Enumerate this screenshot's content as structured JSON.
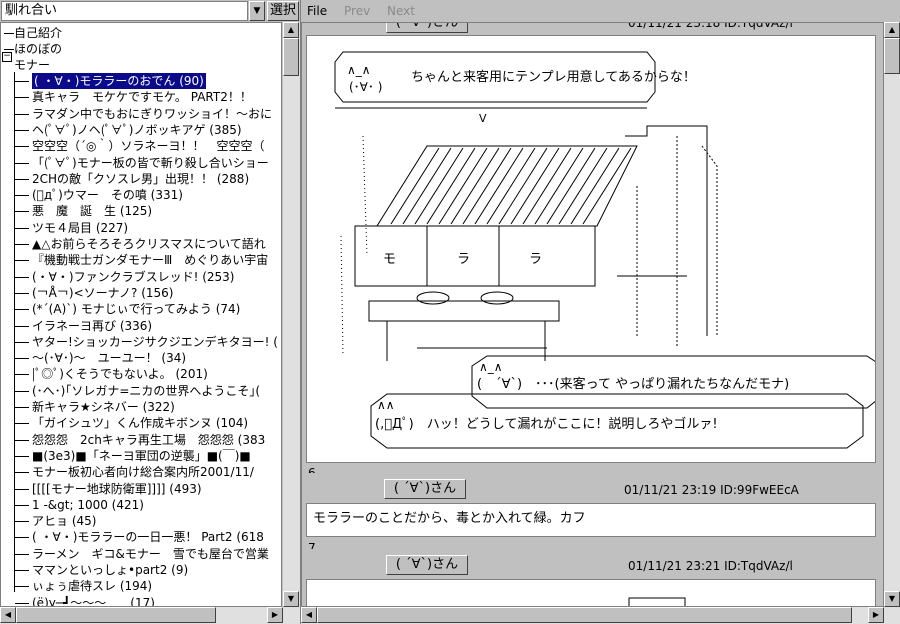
{
  "board": {
    "selected": "馴れ合い",
    "select_label": "選択"
  },
  "menu": {
    "file": "File",
    "prev": "Prev",
    "next": "Next"
  },
  "tree": {
    "top_items": [
      "自己紹介",
      "ほのぼの"
    ],
    "category": "モナー",
    "items": [
      "( ・∀・)モララーのおでん (90)",
      "真キャラ　モケケですモケ。 PART2！！",
      "ラマダン中でもおにぎりワッショイ！～おに",
      "ヘ(ﾟ∀ﾟ)ノヘ(ﾟ∀ﾟ)ノボッキアゲ (385)",
      "空空空（´◎｀）ソラネーヨ！！　空空空（",
      "「(ﾟ∀ﾟ)モナー板の皆で斬り殺し合いショー",
      "2CHの敵「クソスレ男」出現！！ (288)",
      "(ﾟдﾟ)ウマー　その噴 (331)",
      "悪　魔　誕　生 (125)",
      "ツモ４局目 (227)",
      "▲△お前らそろそろクリスマスについて語れ",
      "『機動戦士ガンダモナーⅢ　めぐりあい宇宙",
      "(・∀・)ファンクラブスレッド! (253)",
      "(￢Å￢)<ソーナノ? (156)",
      "(*´(A)`) モナじぃで行ってみよう (74)",
      "イラネーヨ再び (336)",
      "ヤター!ショッカージサクジエンデキタヨー! (",
      "～(･∀･)～　ユーユー！ (34)",
      "|ﾟ◎ﾟ)くそうでもないよ。 (201)",
      "(･へ･)｢ソレガナ=ニカの世界へようこそ｣(",
      "新キャラ★シネバー (322)",
      "「ガイシュツ」くん作成キボンヌ (104)",
      "怨怨怨　2chキャラ再生工場　怨怨怨 (383",
      "■(3e3)■「ネーヨ軍団の逆襲」■(￣)■",
      "モナー板初心者向け総合案内所2001/11/",
      "[[[[モナー地球防衛軍]]]] (493)",
      "1 -&gt; 1000 (421)",
      "アヒョ (45)",
      "( ・∀・)モララーの一日一悪！ Part2 (618",
      "ラーメン　ギコ&モナー　雪でも屋台で営業",
      "ママンといっしょ•part2 (9)",
      "ぃょぅ虐待スレ (194)",
      "(ё)y─┛～～～　　(17)"
    ]
  },
  "thread": {
    "top_header_date": "01/11/21 23:18 ID:TqdVAz/l",
    "top_header_name": "( ´∀`)さん",
    "aa": {
      "speech1": "ちゃんと来客用にテンプレ用意してあるからな！",
      "face1_top": "∧_∧",
      "face1_bot": "(･∀･ )",
      "shop_m": "モ",
      "shop_ra1": "ラ",
      "shop_ra2": "ラ",
      "speech2": "(　´∀`)　･･･(来客って やっぱり漏れたちなんだモナ)",
      "face2_top": "∧_∧",
      "speech3": "(,ﾟДﾟ)　ハッ！どうして漏れがここに！説明しろやゴルァ!",
      "face3_top": "∧∧"
    },
    "posts": [
      {
        "number": "6",
        "name": "( ´∀`)さん",
        "date": "01/11/21 23:19 ID:99FwEEcA",
        "message": "モララーのことだから、毒とか入れて緑。カフ"
      },
      {
        "number": "7",
        "name": "( ´∀`)さん",
        "date": "01/11/21 23:21 ID:TqdVAz/l",
        "message": ""
      }
    ]
  }
}
